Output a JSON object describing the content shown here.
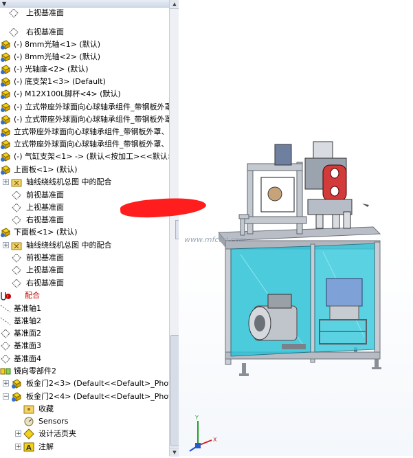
{
  "feature_tree": {
    "rows": [
      {
        "label": "上视基准面",
        "icon": "plane-icon"
      },
      {
        "label": "右视基准面",
        "icon": "plane-icon"
      },
      {
        "label": "(-) 8mm光轴<1> (默认)",
        "icon": "part-icon"
      },
      {
        "label": "(-) 8mm光轴<2> (默认)",
        "icon": "part-icon"
      },
      {
        "label": "(-) 光轴座<2> (默认)",
        "icon": "part-icon"
      },
      {
        "label": "(-) 底支架1<3> (Default)",
        "icon": "part-icon"
      },
      {
        "label": "(-) M12X100L脚杯<4> (默认)",
        "icon": "part-icon"
      },
      {
        "label": "(-) 立式带座外球面向心球轴承组件_带钢板外罩",
        "icon": "part-icon"
      },
      {
        "label": "(-) 立式带座外球面向心球轴承组件_带钢板外罩",
        "icon": "part-icon"
      },
      {
        "label": "立式带座外球面向心球轴承组件_带钢板外罩、",
        "icon": "part-icon"
      },
      {
        "label": "立式带座外球面向心球轴承组件_带钢板外罩、",
        "icon": "part-icon"
      },
      {
        "label": "(-) 气缸支架<1> -> (默认<按加工><<默认>",
        "icon": "part-icon"
      },
      {
        "label": "上面板<1> (默认)",
        "icon": "part-icon"
      },
      {
        "label": "轴线绕线机总图 中的配合",
        "icon": "mate-folder-icon"
      },
      {
        "label": "前视基准面",
        "icon": "plane-icon"
      },
      {
        "label": "上视基准面",
        "icon": "plane-icon"
      },
      {
        "label": "右视基准面",
        "icon": "plane-icon"
      },
      {
        "label": "下面板<1> (默认)",
        "icon": "part-icon"
      },
      {
        "label": "轴线绕线机总图 中的配合",
        "icon": "mate-folder-icon"
      },
      {
        "label": "前视基准面",
        "icon": "plane-icon"
      },
      {
        "label": "上视基准面",
        "icon": "plane-icon"
      },
      {
        "label": "右视基准面",
        "icon": "plane-icon"
      },
      {
        "label": "配合",
        "icon": "mates-icon"
      },
      {
        "label": "基准轴1",
        "icon": "axis-icon"
      },
      {
        "label": "基准轴2",
        "icon": "axis-icon"
      },
      {
        "label": "基准面2",
        "icon": "plane-icon"
      },
      {
        "label": "基准面3",
        "icon": "plane-icon"
      },
      {
        "label": "基准面4",
        "icon": "plane-icon"
      },
      {
        "label": "镜向零部件2",
        "icon": "mirror-icon"
      },
      {
        "label": "板金门2<3> (Default<<Default>_Photo",
        "icon": "part-icon"
      },
      {
        "label": "板金门2<4> (Default<<Default>_Photo",
        "icon": "part-icon"
      },
      {
        "label": "收藏",
        "icon": "favorites-icon"
      },
      {
        "label": "Sensors",
        "icon": "sensors-icon"
      },
      {
        "label": "设计活页夹",
        "icon": "binder-icon"
      },
      {
        "label": "注解",
        "icon": "annotation-icon"
      }
    ]
  },
  "viewport": {
    "watermark_text": "www.mfcad.com",
    "bg_top": "#ffffff",
    "bg_bottom": "#f4f7fb"
  },
  "colors": {
    "accent": "#1f78c8",
    "mate_red": "#c00000",
    "glass": "#29c2d6",
    "frame": "#c8ccd2"
  }
}
